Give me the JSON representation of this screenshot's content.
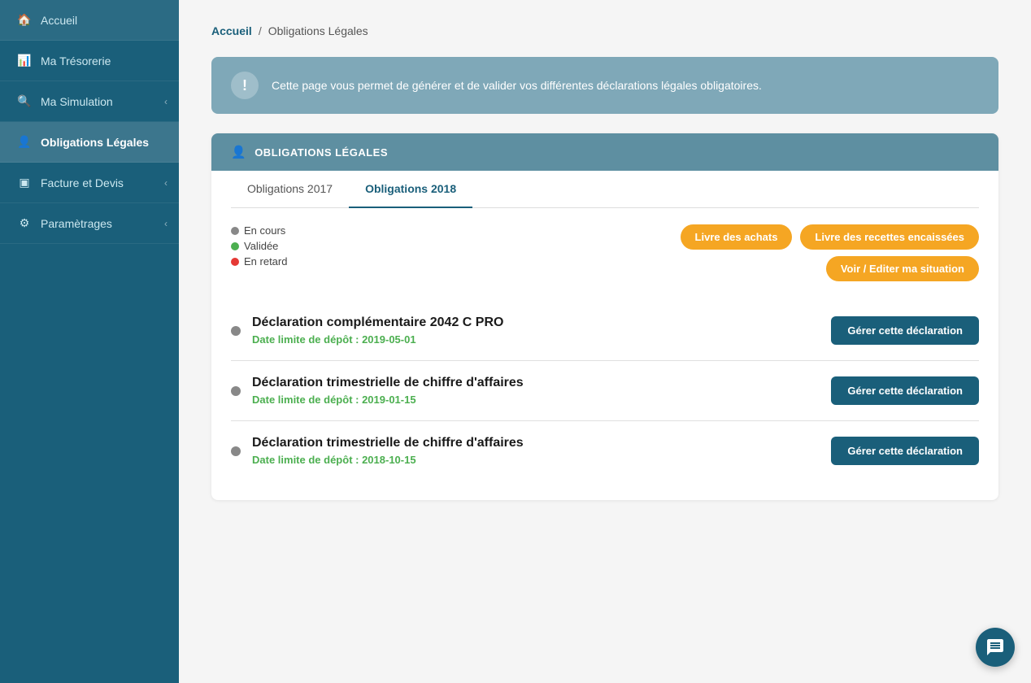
{
  "sidebar": {
    "items": [
      {
        "id": "accueil",
        "label": "Accueil",
        "icon": "🏠",
        "active": false,
        "hasChevron": false
      },
      {
        "id": "tresorerie",
        "label": "Ma Trésorerie",
        "icon": "📊",
        "active": false,
        "hasChevron": false
      },
      {
        "id": "simulation",
        "label": "Ma Simulation",
        "icon": "🔍",
        "active": false,
        "hasChevron": true
      },
      {
        "id": "obligations",
        "label": "Obligations Légales",
        "icon": "👤",
        "active": true,
        "hasChevron": false
      },
      {
        "id": "facture",
        "label": "Facture et Devis",
        "icon": "▣",
        "active": false,
        "hasChevron": true
      },
      {
        "id": "parametrages",
        "label": "Paramètrages",
        "icon": "⚙",
        "active": false,
        "hasChevron": true
      }
    ]
  },
  "breadcrumb": {
    "home": "Accueil",
    "separator": "/",
    "current": "Obligations Légales"
  },
  "alert": {
    "icon": "!",
    "text": "Cette page vous permet de générer et de valider vos différentes déclarations légales obligatoires."
  },
  "card": {
    "header_icon": "👤",
    "header_title": "OBLIGATIONS LÉGALES",
    "tabs": [
      {
        "id": "2017",
        "label": "Obligations 2017",
        "active": false
      },
      {
        "id": "2018",
        "label": "Obligations 2018",
        "active": true
      }
    ],
    "legend": [
      {
        "color": "grey",
        "label": "En cours"
      },
      {
        "color": "green",
        "label": "Validée"
      },
      {
        "color": "red",
        "label": "En retard"
      }
    ],
    "action_buttons": [
      {
        "id": "livre-achats",
        "label": "Livre des achats"
      },
      {
        "id": "livre-recettes",
        "label": "Livre des recettes encaissées"
      },
      {
        "id": "voir-editer",
        "label": "Voir / Editer ma situation"
      }
    ],
    "declarations": [
      {
        "id": "decl-1",
        "title": "Déclaration complémentaire 2042 C PRO",
        "date": "Date limite de dépôt : 2019-05-01",
        "button": "Gérer cette déclaration",
        "status": "grey"
      },
      {
        "id": "decl-2",
        "title": "Déclaration trimestrielle de chiffre d'affaires",
        "date": "Date limite de dépôt : 2019-01-15",
        "button": "Gérer cette déclaration",
        "status": "grey"
      },
      {
        "id": "decl-3",
        "title": "Déclaration trimestrielle de chiffre d'affaires",
        "date": "Date limite de dépôt : 2018-10-15",
        "button": "Gérer cette déclaration",
        "status": "grey"
      }
    ]
  },
  "chat": {
    "icon": "💬"
  },
  "colors": {
    "sidebar_bg": "#1a5f7a",
    "accent": "#f5a623",
    "manage_btn": "#1a5f7a"
  }
}
